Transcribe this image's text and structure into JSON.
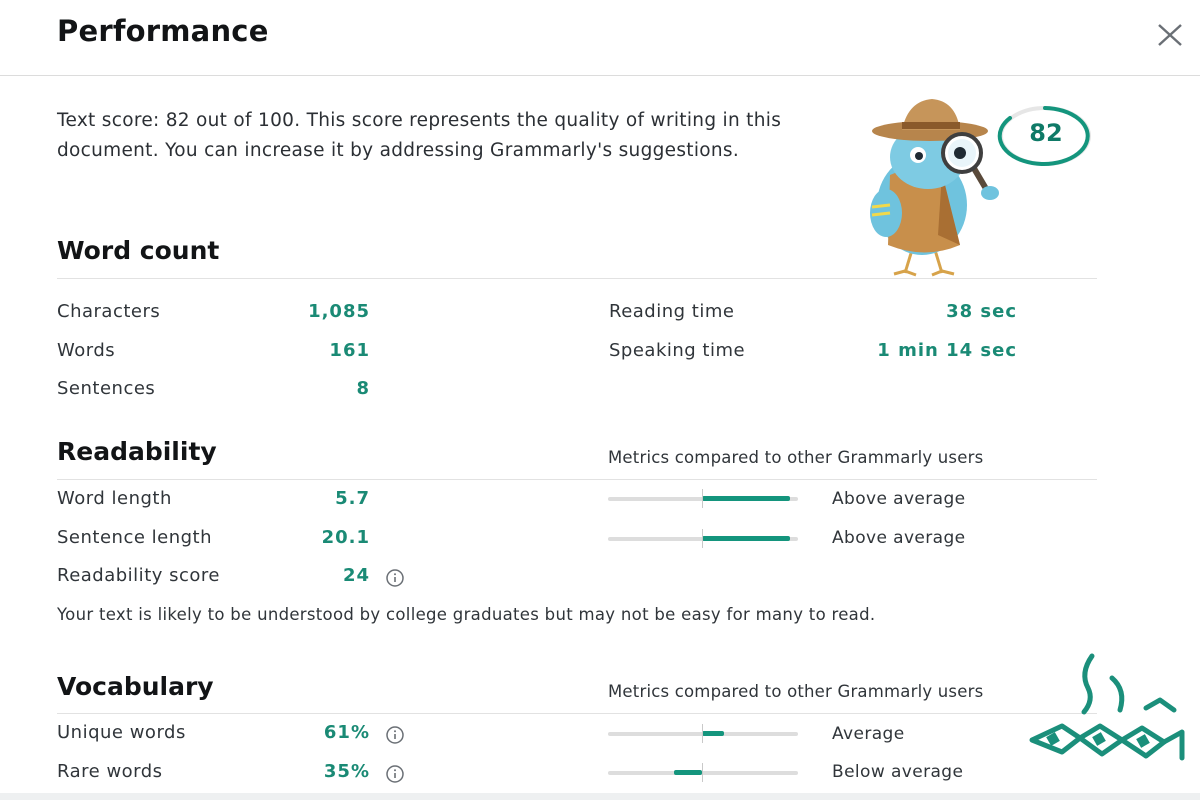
{
  "header": {
    "title": "Performance",
    "close_icon": "close-icon"
  },
  "intro": {
    "text": "Text score: 82 out of 100. This score represents the quality of writing in this document. You can increase it by addressing Grammarly's suggestions."
  },
  "score": {
    "value": "82",
    "percent": 82,
    "ring_color": "#14957d"
  },
  "word_count": {
    "title": "Word count",
    "characters_label": "Characters",
    "characters_value": "1,085",
    "words_label": "Words",
    "words_value": "161",
    "sentences_label": "Sentences",
    "sentences_value": "8",
    "reading_label": "Reading time",
    "reading_value": "38 sec",
    "speaking_label": "Speaking time",
    "speaking_value": "1 min 14 sec"
  },
  "readability": {
    "title": "Readability",
    "compare_note": "Metrics compared to other Grammarly users",
    "word_length_label": "Word length",
    "word_length_value": "5.7",
    "word_length_rating": "Above average",
    "sentence_length_label": "Sentence length",
    "sentence_length_value": "20.1",
    "sentence_length_rating": "Above average",
    "score_label": "Readability score",
    "score_value": "24",
    "message": "Your text is likely to be understood by college graduates but may not be easy for many to read."
  },
  "vocabulary": {
    "title": "Vocabulary",
    "compare_note": "Metrics compared to other Grammarly users",
    "unique_label": "Unique words",
    "unique_value": "61%",
    "unique_rating": "Average",
    "rare_label": "Rare words",
    "rare_value": "35%",
    "rare_rating": "Below average"
  },
  "colors": {
    "accent": "#14957d",
    "value_text": "#1a8a75"
  }
}
